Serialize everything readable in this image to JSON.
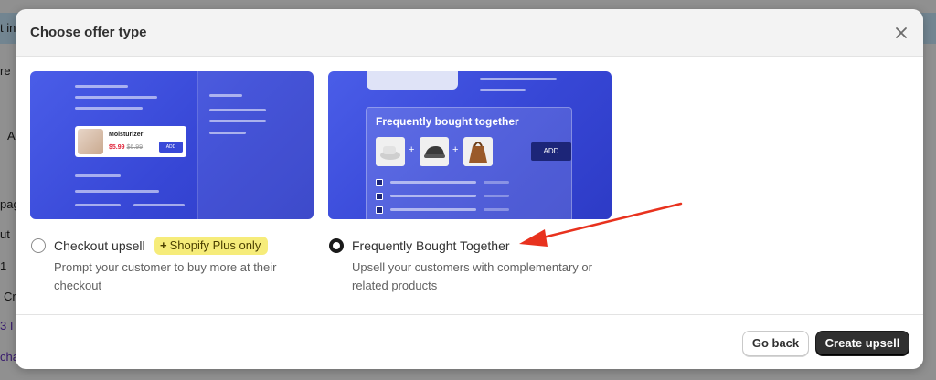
{
  "background": {
    "banner_text": "t in",
    "left_texts": [
      "re",
      "A",
      "pag",
      "ut",
      "1",
      "Cr",
      "3 I",
      "cha"
    ]
  },
  "modal": {
    "title": "Choose offer type",
    "close_icon": "close-icon"
  },
  "options": [
    {
      "title": "Checkout upsell",
      "badge": "Shopify Plus only",
      "badge_icon": "plus-icon",
      "description": "Prompt your customer to buy more at their checkout",
      "selected": false,
      "illustration": {
        "product_name": "Moisturizer",
        "price": "$5.99",
        "old_price": "$6.99",
        "add_label": "ADD"
      }
    },
    {
      "title": "Frequently Bought Together",
      "description": "Upsell your customers with complementary or related products",
      "selected": true,
      "illustration": {
        "panel_title": "Frequently bought together",
        "add_label": "ADD"
      }
    }
  ],
  "footer": {
    "back_label": "Go back",
    "create_label": "Create upsell"
  },
  "colors": {
    "annotation_arrow": "#e8321e",
    "primary_button": "#303030",
    "badge": "#f6ec7a"
  }
}
